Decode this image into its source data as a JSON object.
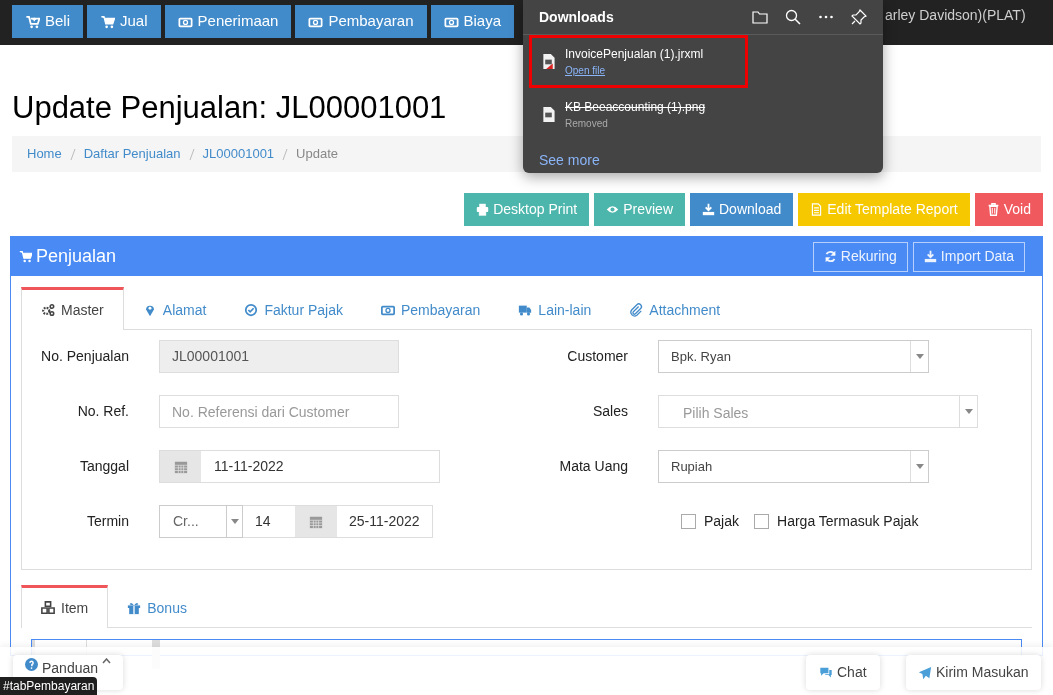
{
  "top_nav": {
    "buttons": [
      {
        "label": "Beli"
      },
      {
        "label": "Jual"
      },
      {
        "label": "Penerimaan"
      },
      {
        "label": "Pembayaran"
      },
      {
        "label": "Biaya"
      }
    ],
    "user": "arley Davidson)(PLAT)"
  },
  "downloads": {
    "title": "Downloads",
    "items": [
      {
        "name": "InvoicePenjualan (1).jrxml",
        "action": "Open file",
        "removed": false,
        "highlighted": true
      },
      {
        "name": "KB Beeaccounting (1).png",
        "status": "Removed",
        "removed": true,
        "highlighted": false
      }
    ],
    "see_more": "See more"
  },
  "page_title": "Update Penjualan: JL00001001",
  "breadcrumb": [
    {
      "label": "Home",
      "current": false
    },
    {
      "label": "Daftar Penjualan",
      "current": false
    },
    {
      "label": "JL00001001",
      "current": false
    },
    {
      "label": "Update",
      "current": true
    }
  ],
  "actions": [
    {
      "label": "Desktop Print",
      "color": "#4db6ac"
    },
    {
      "label": "Preview",
      "color": "#4db6ac"
    },
    {
      "label": "Download",
      "color": "#428bca"
    },
    {
      "label": "Edit Template Report",
      "color": "#f5c800"
    },
    {
      "label": "Void",
      "color": "#f05a5f"
    }
  ],
  "panel": {
    "title": "Penjualan",
    "buttons": [
      {
        "label": "Rekuring"
      },
      {
        "label": "Import Data"
      }
    ]
  },
  "tabs": [
    {
      "label": "Master",
      "selected": true
    },
    {
      "label": "Alamat",
      "selected": false
    },
    {
      "label": "Faktur Pajak",
      "selected": false
    },
    {
      "label": "Pembayaran",
      "selected": false
    },
    {
      "label": "Lain-lain",
      "selected": false
    },
    {
      "label": "Attachment",
      "selected": false
    }
  ],
  "form_left": [
    {
      "label": "No. Penjualan",
      "kind": "readonly",
      "value": "JL00001001"
    },
    {
      "label": "No. Ref.",
      "kind": "text",
      "placeholder": "No. Referensi dari Customer"
    },
    {
      "label": "Tanggal",
      "kind": "date",
      "value": "11-11-2022"
    },
    {
      "label": "Termin",
      "kind": "termin",
      "select": "Cr...",
      "days": "14",
      "date": "25-11-2022"
    }
  ],
  "form_right": [
    {
      "label": "Customer",
      "kind": "select",
      "value": "Bpk. Ryan"
    },
    {
      "label": "Sales",
      "kind": "select",
      "placeholder": "Pilih Sales"
    },
    {
      "label": "Mata Uang",
      "kind": "select",
      "value": "Rupiah"
    }
  ],
  "checkboxes": [
    {
      "label": "Pajak",
      "checked": false
    },
    {
      "label": "Harga Termasuk Pajak",
      "checked": false
    }
  ],
  "item_tabs": [
    {
      "label": "Item",
      "selected": true
    },
    {
      "label": "Bonus",
      "selected": false
    }
  ],
  "footer": {
    "guide": "Panduan",
    "chat": "Chat",
    "feedback": "Kirim Masukan"
  },
  "tooltip": "#tabPembayaran"
}
